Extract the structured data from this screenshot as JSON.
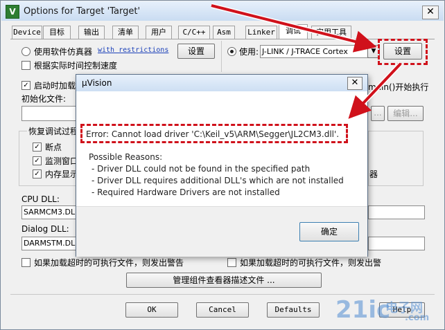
{
  "window": {
    "title": "Options for Target 'Target'",
    "close": "✕"
  },
  "tabs": [
    "Device",
    "目标",
    "输出",
    "清单",
    "用户",
    "C/C++",
    "Asm",
    "Linker",
    "调试",
    "实用工具"
  ],
  "left": {
    "use_simulator": "使用软件仿真器",
    "restrictions": "with restrictions",
    "settings": "设置",
    "speed_limit": "根据实际时间控制速度",
    "load_app": "启动时加载",
    "init_file": "初始化文件:",
    "restore_group": "恢复调试过程",
    "breakpoints": "断点",
    "watch": "监测窗口",
    "memory": "内存显示",
    "cpu_dll_label": "CPU DLL:",
    "cpu_dll": "SARMCM3.DLL",
    "dialog_dll_label": "Dialog DLL:",
    "dialog_dll": "DARMSTM.DLL",
    "warn_timeout": "如果加载超时的可执行文件，则发出警告"
  },
  "right": {
    "use": "使用:",
    "driver": "J-LINK / J-TRACE Cortex",
    "settings": "设置",
    "run_to_main": "main()开始执行",
    "browse": "...",
    "edit": "编辑...",
    "warn_timeout": "如果加载超时的可执行文件，则发出警"
  },
  "manage_button": "管理组件查看器描述文件 ...",
  "footer": {
    "ok": "OK",
    "cancel": "Cancel",
    "defaults": "Defaults",
    "help": "Help"
  },
  "dialog": {
    "title": "µVision",
    "close": "✕",
    "error": "Error: Cannot load driver 'C:\\Keil_v5\\ARM\\Segger\\JL2CM3.dll'.",
    "reasons_title": "Possible Reasons:",
    "reasons": [
      "- Driver DLL could not be found in the specified path",
      "- Driver DLL requires additional DLL's which are not installed",
      "- Required Hardware Drivers are not installed"
    ],
    "ok": "确定"
  },
  "watermark": {
    "site": "21ic",
    "cn": "电子网",
    "domain": ".com"
  },
  "colors": {
    "highlight": "#d0111b",
    "link": "#1a3fb8"
  }
}
